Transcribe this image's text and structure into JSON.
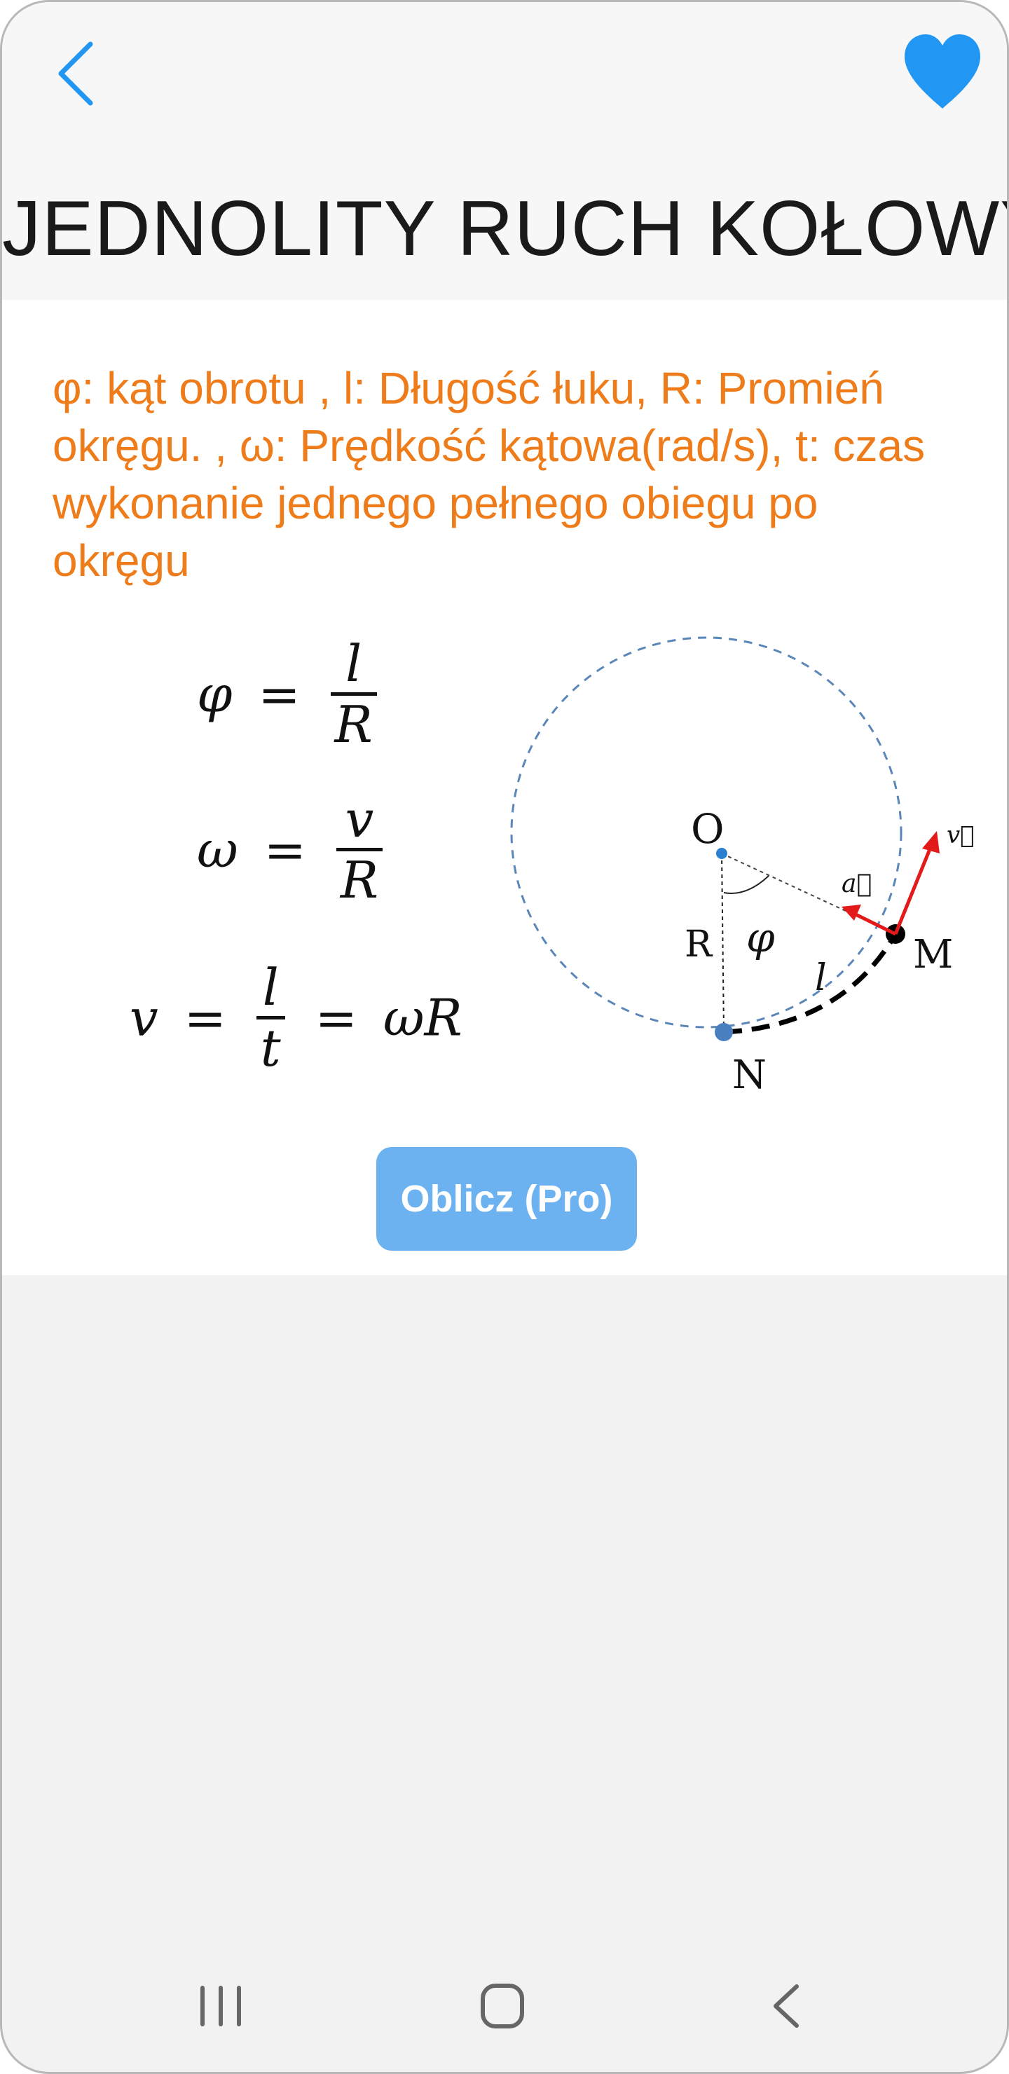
{
  "header": {
    "title": "JEDNOLITY RUCH KOŁOWY",
    "back_icon": "chevron-left-icon",
    "favorite_icon": "heart-icon"
  },
  "content": {
    "description": "φ: kąt obrotu , l: Długość łuku, R: Promień okręgu. , ω: Prędkość kątowa(rad/s), t: czas wykonanie jednego pełnego obiegu po okręgu",
    "formulas": {
      "f1": {
        "lhs": "φ",
        "num": "l",
        "den": "R"
      },
      "f2": {
        "lhs": "ω",
        "num": "v",
        "den": "R"
      },
      "f3": {
        "lhs": "v",
        "num": "l",
        "den": "t",
        "rhs": "ωR"
      },
      "equals": "="
    },
    "diagram": {
      "label_o": "O",
      "label_r": "R",
      "label_phi": "φ",
      "label_a": "a⃗",
      "label_v": "v⃗",
      "label_l": "l",
      "label_m": "M",
      "label_n": "N"
    },
    "calc_button": "Oblicz (Pro)"
  },
  "colors": {
    "accent_blue": "#2196f3",
    "description_orange": "#ee7c1a",
    "button_blue": "#6cb2f0",
    "vector_red": "#e31a1a",
    "circle_dash": "#5a86b8"
  },
  "navbar": {
    "recent_icon": "recent-apps-icon",
    "home_icon": "home-icon",
    "back_icon": "back-icon"
  }
}
